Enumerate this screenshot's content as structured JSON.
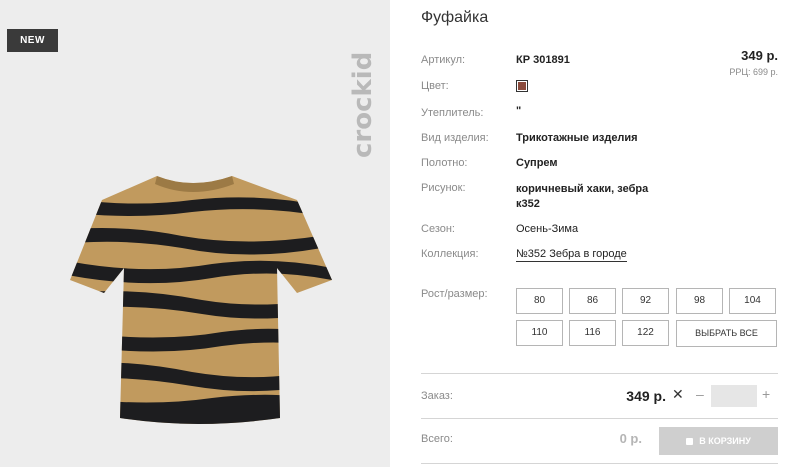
{
  "product": {
    "badge": "NEW",
    "brand": "crockid",
    "title": "Фуфайка"
  },
  "attributes": [
    {
      "label": "Артикул:",
      "value": "КР 301891"
    },
    {
      "label": "Цвет:",
      "value": ""
    },
    {
      "label": "Утеплитель:",
      "value": "\""
    },
    {
      "label": "Вид изделия:",
      "value": "Трикотажные изделия"
    },
    {
      "label": "Полотно:",
      "value": "Супрем"
    },
    {
      "label": "Рисунок:",
      "value": "коричневый хаки, зебра к352"
    },
    {
      "label": "Сезон:",
      "value": "Осень-Зима"
    },
    {
      "label": "Коллекция:",
      "value": "№352 Зебра в городе"
    }
  ],
  "price": {
    "value": "349 р.",
    "rrp": "РРЦ: 699 р."
  },
  "color_swatch": "#8b4a3c",
  "sizes": {
    "label": "Рост/размер:",
    "options": [
      "80",
      "86",
      "92",
      "98",
      "104",
      "110",
      "116",
      "122"
    ],
    "select_all": "ВЫБРАТЬ ВСЕ"
  },
  "order": {
    "label": "Заказ:",
    "price": "349 р.",
    "times": "✕",
    "minus": "–",
    "plus": "+",
    "qty": ""
  },
  "total": {
    "label": "Всего:",
    "value": "0 р."
  },
  "cart_button": "В КОРЗИНУ"
}
